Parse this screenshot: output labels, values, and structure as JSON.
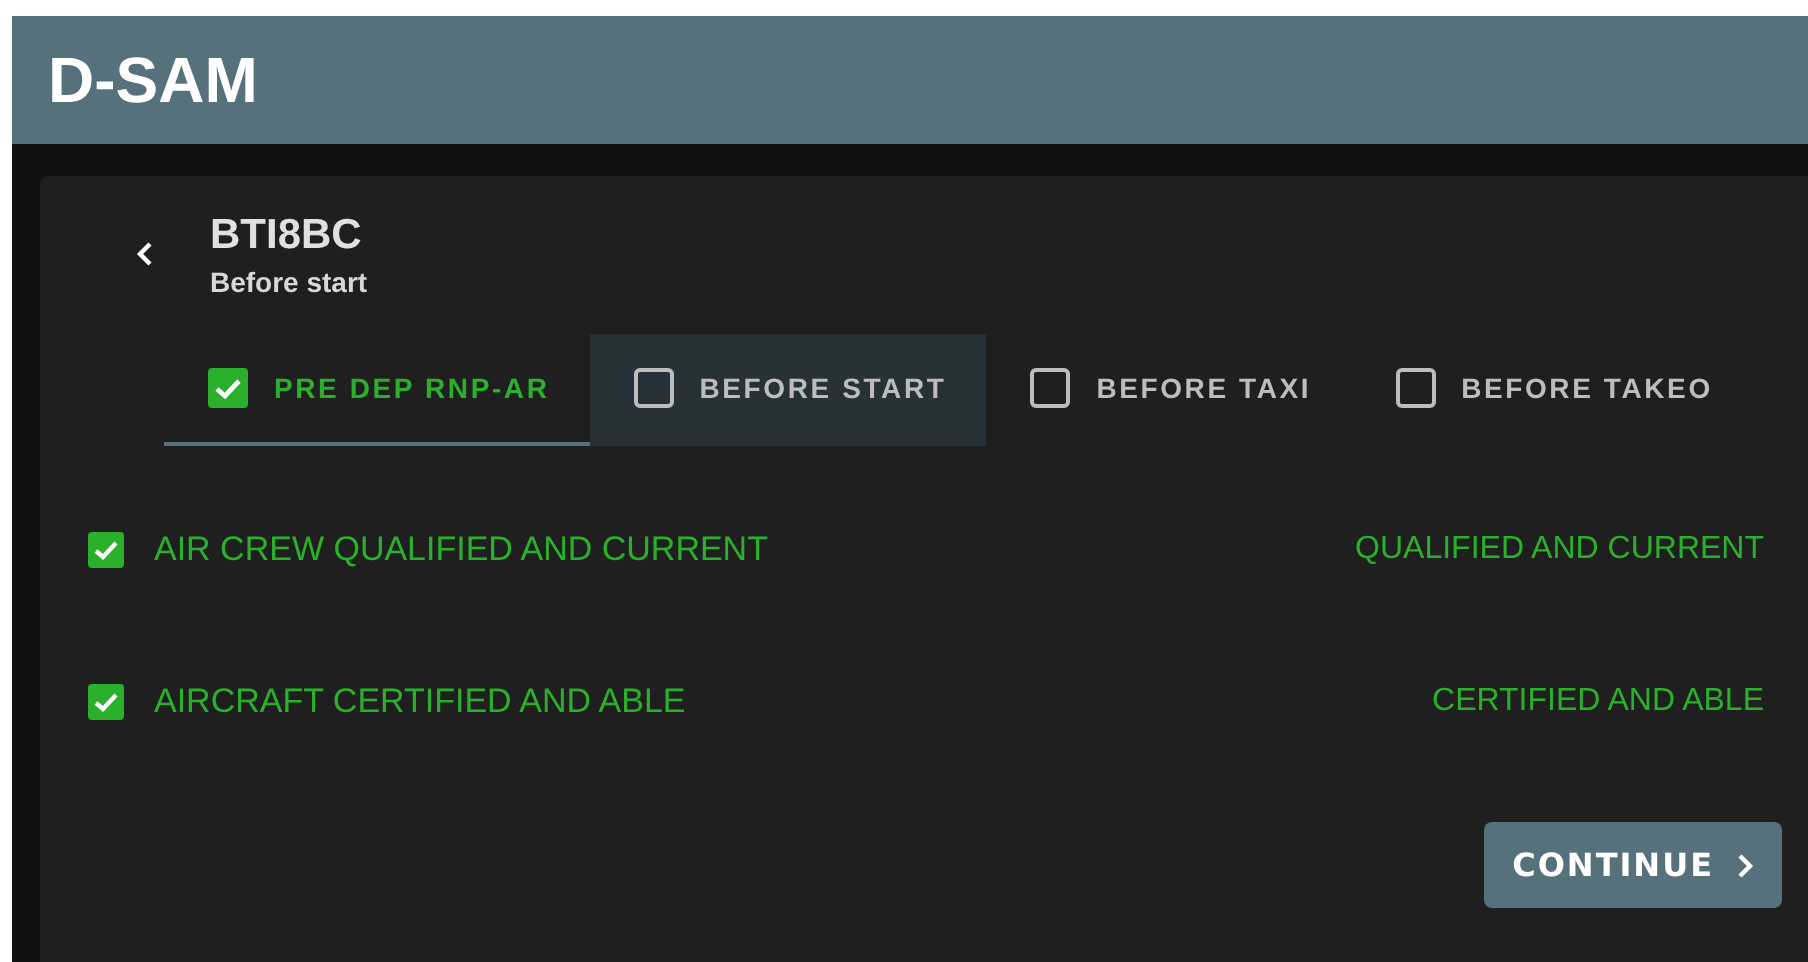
{
  "app_bar": {
    "title": "D-SAM"
  },
  "header": {
    "title": "BTI8BC",
    "subtitle": "Before start"
  },
  "tabs": [
    {
      "label": "PRE DEP RNP-AR",
      "checked": true,
      "selected": true,
      "hovered": false
    },
    {
      "label": "BEFORE START",
      "checked": false,
      "selected": false,
      "hovered": true
    },
    {
      "label": "BEFORE TAXI",
      "checked": false,
      "selected": false,
      "hovered": false
    },
    {
      "label": "BEFORE TAKEO",
      "checked": false,
      "selected": false,
      "hovered": false
    }
  ],
  "items": [
    {
      "label": "AIR CREW QUALIFIED AND CURRENT",
      "value": "QUALIFIED AND CURRENT",
      "checked": true
    },
    {
      "label": "AIRCRAFT CERTIFIED AND ABLE",
      "value": "CERTIFIED AND ABLE",
      "checked": true
    }
  ],
  "continue_button": {
    "label": "CONTINUE"
  }
}
